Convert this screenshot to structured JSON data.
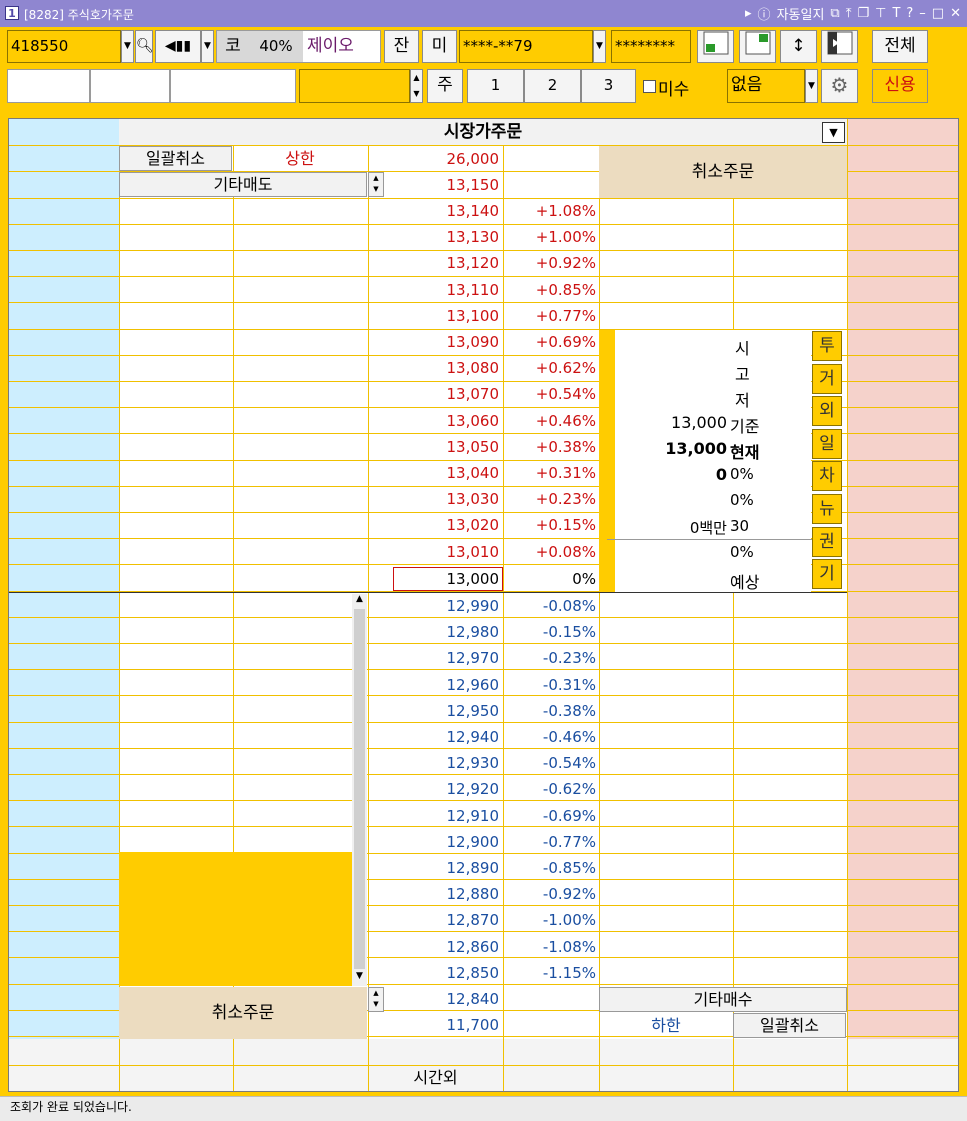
{
  "window": {
    "id": "[8282]",
    "title": "주식호가주문",
    "auto_log": "자동일지",
    "app_num": "1"
  },
  "toolbar": {
    "code": "418550",
    "market": "코",
    "margin": "40%",
    "stock_name": "제이오",
    "btn_jan": "잔",
    "btn_mi": "미",
    "account": "****-**79",
    "password": "********",
    "btn_all": "전체",
    "btn_ju": "주",
    "qty1": "1",
    "qty2": "2",
    "qty3": "3",
    "misu_label": "미수",
    "select_value": "없음",
    "btn_credit": "신용"
  },
  "header": {
    "order_type": "시장가주문"
  },
  "top": {
    "cancel_all": "일괄취소",
    "upper_label": "상한",
    "upper_price": "26,000",
    "other_sell": "기타매도",
    "top_price": "13,150",
    "cancel_order": "취소주문"
  },
  "asks": [
    {
      "p": "13,140",
      "r": "+1.08%"
    },
    {
      "p": "13,130",
      "r": "+1.00%"
    },
    {
      "p": "13,120",
      "r": "+0.92%"
    },
    {
      "p": "13,110",
      "r": "+0.85%"
    },
    {
      "p": "13,100",
      "r": "+0.77%"
    },
    {
      "p": "13,090",
      "r": "+0.69%"
    },
    {
      "p": "13,080",
      "r": "+0.62%"
    },
    {
      "p": "13,070",
      "r": "+0.54%"
    },
    {
      "p": "13,060",
      "r": "+0.46%"
    },
    {
      "p": "13,050",
      "r": "+0.38%"
    },
    {
      "p": "13,040",
      "r": "+0.31%"
    },
    {
      "p": "13,030",
      "r": "+0.23%"
    },
    {
      "p": "13,020",
      "r": "+0.15%"
    },
    {
      "p": "13,010",
      "r": "+0.08%"
    }
  ],
  "current": {
    "p": "13,000",
    "r": "0%"
  },
  "bids": [
    {
      "p": "12,990",
      "r": "-0.08%"
    },
    {
      "p": "12,980",
      "r": "-0.15%"
    },
    {
      "p": "12,970",
      "r": "-0.23%"
    },
    {
      "p": "12,960",
      "r": "-0.31%"
    },
    {
      "p": "12,950",
      "r": "-0.38%"
    },
    {
      "p": "12,940",
      "r": "-0.46%"
    },
    {
      "p": "12,930",
      "r": "-0.54%"
    },
    {
      "p": "12,920",
      "r": "-0.62%"
    },
    {
      "p": "12,910",
      "r": "-0.69%"
    },
    {
      "p": "12,900",
      "r": "-0.77%"
    },
    {
      "p": "12,890",
      "r": "-0.85%"
    },
    {
      "p": "12,880",
      "r": "-0.92%"
    },
    {
      "p": "12,870",
      "r": "-1.00%"
    },
    {
      "p": "12,860",
      "r": "-1.08%"
    },
    {
      "p": "12,850",
      "r": "-1.15%"
    }
  ],
  "info": {
    "open": "시",
    "high": "고",
    "low": "저",
    "base_val": "13,000",
    "base_label": "기준",
    "cur_val": "13,000",
    "cur_label": "현재",
    "chg_val": "0",
    "chg_pct": "0%",
    "pct2": "0%",
    "vol_val": "0백만",
    "vol_num": "30",
    "pct3": "0%",
    "expected": "예상"
  },
  "side_tabs": [
    "투",
    "거",
    "외",
    "일",
    "차",
    "뉴",
    "권",
    "기"
  ],
  "bottom": {
    "cancel_order": "취소주문",
    "bottom_price": "12,840",
    "other_buy": "기타매수",
    "lower_price": "11,700",
    "lower_label": "하한",
    "cancel_all": "일괄취소",
    "after_hours": "시간외"
  },
  "status": {
    "message": "조회가 완료 되었습니다."
  },
  "colors": {
    "yellow": "#ffcc00",
    "ask_red": "#cc1111",
    "bid_blue": "#1a4ea0",
    "title_purple": "#8f86d0"
  }
}
